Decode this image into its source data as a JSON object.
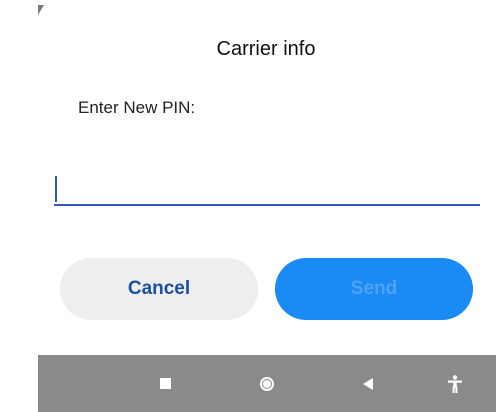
{
  "dialog": {
    "title": "Carrier info",
    "prompt": "Enter New PIN:",
    "pin_value": "",
    "pin_placeholder": "",
    "cancel_label": "Cancel",
    "send_label": "Send"
  },
  "navbar": {
    "items": [
      {
        "icon": "recents-icon"
      },
      {
        "icon": "home-icon"
      },
      {
        "icon": "back-icon"
      },
      {
        "icon": "accessibility-icon"
      }
    ]
  },
  "colors": {
    "accent": "#1a8af5",
    "field_underline": "#2f5bb7",
    "cancel_text": "#1c4fa0",
    "navbar": "#8a8a8a"
  }
}
